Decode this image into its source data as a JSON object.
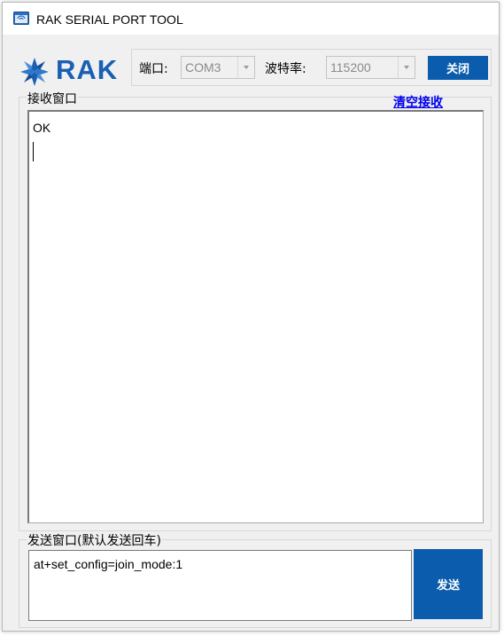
{
  "window": {
    "title": "RAK SERIAL PORT TOOL",
    "icon": "app-window-icon"
  },
  "header": {
    "logo_text": "RAK",
    "logo_icon": "rak-logo-icon",
    "brand_color": "#1a5fb4",
    "port_label": "端口:",
    "port_value": "COM3",
    "baud_label": "波特率:",
    "baud_value": "115200",
    "close_button_label": "关闭"
  },
  "receive": {
    "group_label": "接收窗口",
    "clear_link_label": "清空接收",
    "content": "OK"
  },
  "send": {
    "group_label": "发送窗口(默认发送回车)",
    "input_value": "at+set_config=join_mode:1",
    "send_button_label": "发送"
  },
  "colors": {
    "accent_button": "#0b5cad",
    "link": "#0000ee",
    "window_bg": "#f0f0f0"
  }
}
